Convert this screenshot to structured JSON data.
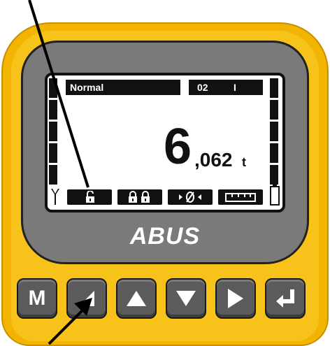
{
  "display": {
    "mode_label": "Normal",
    "channel_label": "02",
    "indicator_label": "I",
    "weight_integer": "6",
    "weight_decimal": ",062",
    "weight_unit": "t"
  },
  "softkeys": [
    {
      "icon": "lock-open-icon"
    },
    {
      "icon": "lock-double-icon"
    },
    {
      "icon": "zero-tare-icon"
    },
    {
      "icon": "ruler-icon"
    }
  ],
  "brand": {
    "name": "ABUS"
  },
  "keypad": {
    "m_label": "M",
    "keys": [
      "menu-m",
      "arrow-diagonal",
      "arrow-up",
      "arrow-down",
      "arrow-right",
      "enter"
    ]
  },
  "colors": {
    "housing": "#f2b400",
    "bezel": "#7a7a7a",
    "key": "#5b5b5b",
    "lcd": "#ffffff"
  }
}
